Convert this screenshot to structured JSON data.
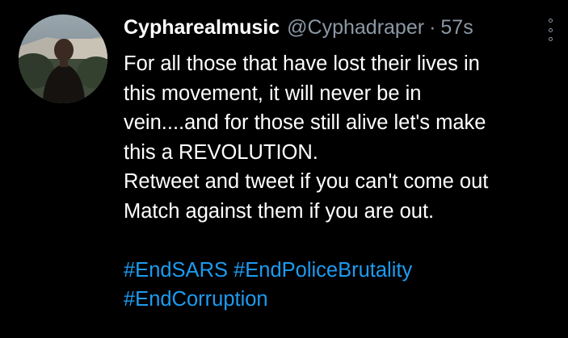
{
  "tweet": {
    "display_name": "Cypharealmusic",
    "handle": "@Cyphadraper",
    "separator": "·",
    "timestamp": "57s",
    "text_lines": [
      "For all those that have lost their lives in",
      "this movement, it will never be in",
      "vein....and for those still alive let's make",
      "this a REVOLUTION.",
      "Retweet and tweet if you can't come out",
      "Match against them if you are out."
    ],
    "hashtags": [
      "#EndSARS",
      "#EndPoliceBrutality",
      "#EndCorruption"
    ]
  },
  "icons": {
    "more": "more-options-icon",
    "avatar": "avatar-photo"
  },
  "colors": {
    "background": "#000000",
    "text": "#ffffff",
    "secondary": "#8b98a5",
    "link": "#1d9bf0"
  }
}
